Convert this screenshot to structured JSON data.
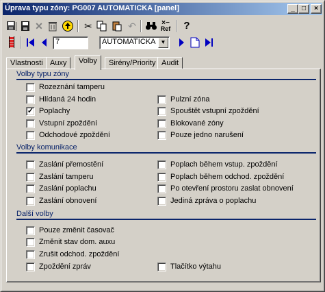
{
  "window": {
    "title": "Úprava typu zóny: PG007 AUTOMATICKA [panel]"
  },
  "titlebar_buttons": [
    "_",
    "□",
    "×"
  ],
  "toolbar": {
    "icons": [
      "save-all-icon",
      "save-icon",
      "delete-icon",
      "trash-icon",
      "refresh-icon",
      "cut-icon",
      "copy-icon",
      "paste-icon",
      "undo-icon",
      "find-icon",
      "ref-icon",
      "help-icon"
    ],
    "ref_label": "Ref",
    "record_number": "7",
    "zone_type_selected": "AUTOMATICKA"
  },
  "tabs": [
    {
      "label": "Vlastnosti",
      "active": false
    },
    {
      "label": "Auxy",
      "active": false
    },
    {
      "label": "Volby",
      "active": true
    },
    {
      "label": "Sirény/Priority",
      "active": false
    },
    {
      "label": "Audit",
      "active": false
    }
  ],
  "sections": [
    {
      "title": "Volby typu zóny",
      "rows": [
        [
          {
            "label": "Rozeznání tamperu",
            "checked": false
          },
          null
        ],
        [
          {
            "label": "Hlídaná 24 hodin",
            "checked": false
          },
          {
            "label": "Pulzní zóna",
            "checked": false
          }
        ],
        [
          {
            "label": "Poplachy",
            "checked": true
          },
          {
            "label": "Spouštět vstupní zpoždění",
            "checked": false
          }
        ],
        [
          {
            "label": "Vstupní zpoždění",
            "checked": false
          },
          {
            "label": "Blokované zóny",
            "checked": false
          }
        ],
        [
          {
            "label": "Odchodové zpoždění",
            "checked": false
          },
          {
            "label": "Pouze jedno narušení",
            "checked": false
          }
        ]
      ]
    },
    {
      "title": "Volby komunikace",
      "rows": [
        [
          {
            "label": "Zaslání přemostění",
            "checked": false
          },
          {
            "label": "Poplach během vstup. zpoždění",
            "checked": false
          }
        ],
        [
          {
            "label": "Zaslání tamperu",
            "checked": false
          },
          {
            "label": "Poplach během odchod. zpoždění",
            "checked": false
          }
        ],
        [
          {
            "label": "Zaslání poplachu",
            "checked": false
          },
          {
            "label": "Po otevření prostoru zaslat obnovení",
            "checked": false
          }
        ],
        [
          {
            "label": "Zaslání obnovení",
            "checked": false
          },
          {
            "label": "Jediná zpráva o poplachu",
            "checked": false
          }
        ]
      ]
    },
    {
      "title": "Další volby",
      "rows": [
        [
          {
            "label": "Pouze změnit časovač",
            "checked": false
          },
          null
        ],
        [
          {
            "label": "Změnit stav dom. auxu",
            "checked": false
          },
          null
        ],
        [
          {
            "label": "Zrušit odchod. zpoždění",
            "checked": false
          },
          null
        ],
        [
          {
            "label": "Zpoždění zpráv",
            "checked": false
          },
          {
            "label": "Tlačítko výtahu",
            "checked": false
          }
        ]
      ]
    }
  ],
  "colors": {
    "titlebar_start": "#0a246a",
    "titlebar_end": "#a6caf0",
    "face": "#d4d0c8",
    "section": "#0a246a",
    "nav_blue": "#0000c0"
  }
}
